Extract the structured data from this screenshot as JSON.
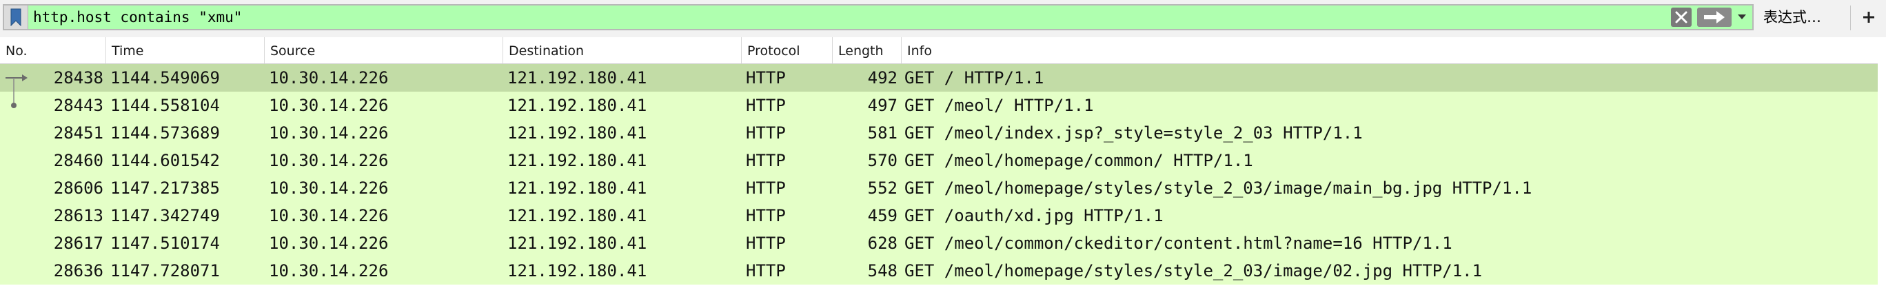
{
  "filter": {
    "value": "http.host contains \"xmu\"",
    "expression_label": "表达式…",
    "add_label": "+",
    "bookmark_icon": "bookmark-icon",
    "clear_icon": "clear-x-icon",
    "apply_icon": "arrow-right-icon",
    "dropdown_icon": "chevron-down-icon",
    "bar_color": "#afffaf"
  },
  "columns": [
    "No.",
    "Time",
    "Source",
    "Destination",
    "Protocol",
    "Length",
    "Info"
  ],
  "row_color": "#e4ffc7",
  "selected_row_color": "#c2dca6",
  "packets": [
    {
      "no": "28438",
      "time": "1144.549069",
      "source": "10.30.14.226",
      "destination": "121.192.180.41",
      "protocol": "HTTP",
      "length": "492",
      "info": "GET / HTTP/1.1",
      "selected": true,
      "marker": "arrow-right-icon"
    },
    {
      "no": "28443",
      "time": "1144.558104",
      "source": "10.30.14.226",
      "destination": "121.192.180.41",
      "protocol": "HTTP",
      "length": "497",
      "info": "GET /meol/ HTTP/1.1",
      "selected": false,
      "marker": "related-dot-icon"
    },
    {
      "no": "28451",
      "time": "1144.573689",
      "source": "10.30.14.226",
      "destination": "121.192.180.41",
      "protocol": "HTTP",
      "length": "581",
      "info": "GET /meol/index.jsp?_style=style_2_03 HTTP/1.1",
      "selected": false,
      "marker": ""
    },
    {
      "no": "28460",
      "time": "1144.601542",
      "source": "10.30.14.226",
      "destination": "121.192.180.41",
      "protocol": "HTTP",
      "length": "570",
      "info": "GET /meol/homepage/common/ HTTP/1.1",
      "selected": false,
      "marker": ""
    },
    {
      "no": "28606",
      "time": "1147.217385",
      "source": "10.30.14.226",
      "destination": "121.192.180.41",
      "protocol": "HTTP",
      "length": "552",
      "info": "GET /meol/homepage/styles/style_2_03/image/main_bg.jpg HTTP/1.1",
      "selected": false,
      "marker": ""
    },
    {
      "no": "28613",
      "time": "1147.342749",
      "source": "10.30.14.226",
      "destination": "121.192.180.41",
      "protocol": "HTTP",
      "length": "459",
      "info": "GET /oauth/xd.jpg HTTP/1.1",
      "selected": false,
      "marker": ""
    },
    {
      "no": "28617",
      "time": "1147.510174",
      "source": "10.30.14.226",
      "destination": "121.192.180.41",
      "protocol": "HTTP",
      "length": "628",
      "info": "GET /meol/common/ckeditor/content.html?name=16 HTTP/1.1",
      "selected": false,
      "marker": ""
    },
    {
      "no": "28636",
      "time": "1147.728071",
      "source": "10.30.14.226",
      "destination": "121.192.180.41",
      "protocol": "HTTP",
      "length": "548",
      "info": "GET /meol/homepage/styles/style_2_03/image/02.jpg HTTP/1.1",
      "selected": false,
      "marker": ""
    }
  ]
}
